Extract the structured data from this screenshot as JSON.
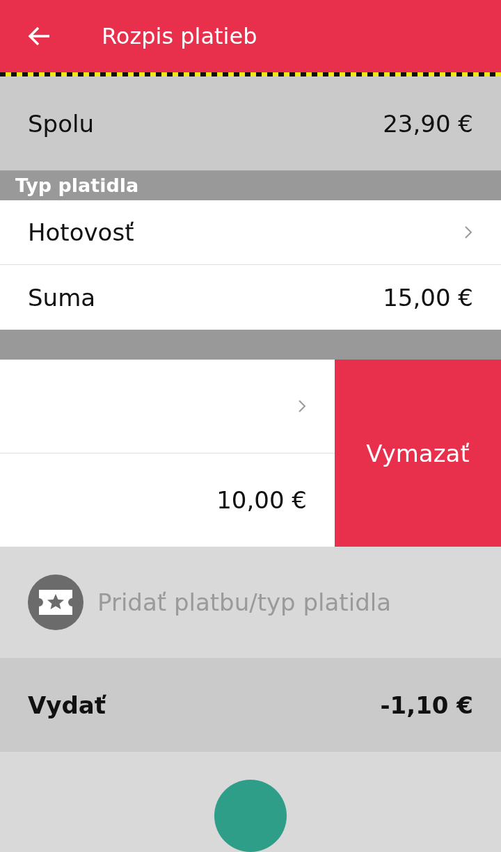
{
  "header": {
    "title": "Rozpis platieb"
  },
  "total": {
    "label": "Spolu",
    "value": "23,90 €"
  },
  "payments": [
    {
      "section_title": "Typ platidla",
      "method": "Hotovosť",
      "amount_label": "Suma",
      "amount": "15,00 €"
    },
    {
      "amount": "10,00 €",
      "delete_action": "Vymazať"
    }
  ],
  "add_payment": {
    "label": "Pridať platbu/typ platidla"
  },
  "change": {
    "label": "Vydať",
    "value": "-1,10 €"
  }
}
